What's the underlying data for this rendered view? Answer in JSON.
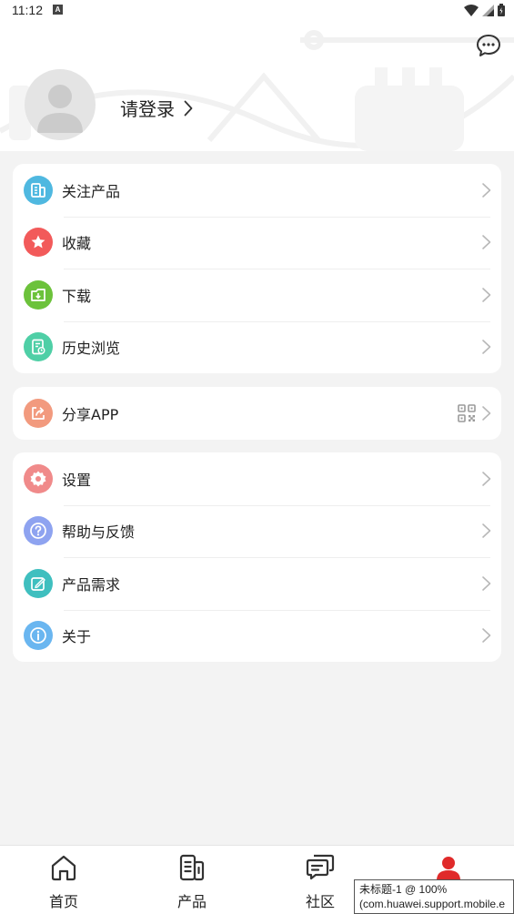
{
  "status_bar": {
    "time": "11:12",
    "notification_icon": "A"
  },
  "header": {
    "message_icon": "chat-bubble-icon",
    "login_label": "请登录"
  },
  "menu_groups": [
    {
      "items": [
        {
          "label": "关注产品",
          "icon": "product-list-icon",
          "color": "#4fb8e0"
        },
        {
          "label": "收藏",
          "icon": "star-icon",
          "color": "#f25a5a"
        },
        {
          "label": "下载",
          "icon": "download-icon",
          "color": "#6cc23b"
        },
        {
          "label": "历史浏览",
          "icon": "history-icon",
          "color": "#4fcfa6"
        }
      ]
    },
    {
      "items": [
        {
          "label": "分享APP",
          "icon": "share-icon",
          "color": "#f29a7e",
          "extra_icon": "qr-code-icon"
        }
      ]
    },
    {
      "items": [
        {
          "label": "设置",
          "icon": "gear-icon",
          "color": "#f08a8a"
        },
        {
          "label": "帮助与反馈",
          "icon": "help-icon",
          "color": "#8ea3f0"
        },
        {
          "label": "产品需求",
          "icon": "edit-icon",
          "color": "#3fbfbf"
        },
        {
          "label": "关于",
          "icon": "info-icon",
          "color": "#6ab6f0"
        }
      ]
    }
  ],
  "tabs": [
    {
      "label": "首页",
      "icon": "home-icon"
    },
    {
      "label": "产品",
      "icon": "product-icon"
    },
    {
      "label": "社区",
      "icon": "community-icon"
    },
    {
      "label": "",
      "icon": "user-icon",
      "active": true,
      "color": "#e02a2a"
    }
  ],
  "tooltip": {
    "line1": "未标题-1 @ 100%",
    "line2": "(com.huawei.support.mobile.e"
  }
}
